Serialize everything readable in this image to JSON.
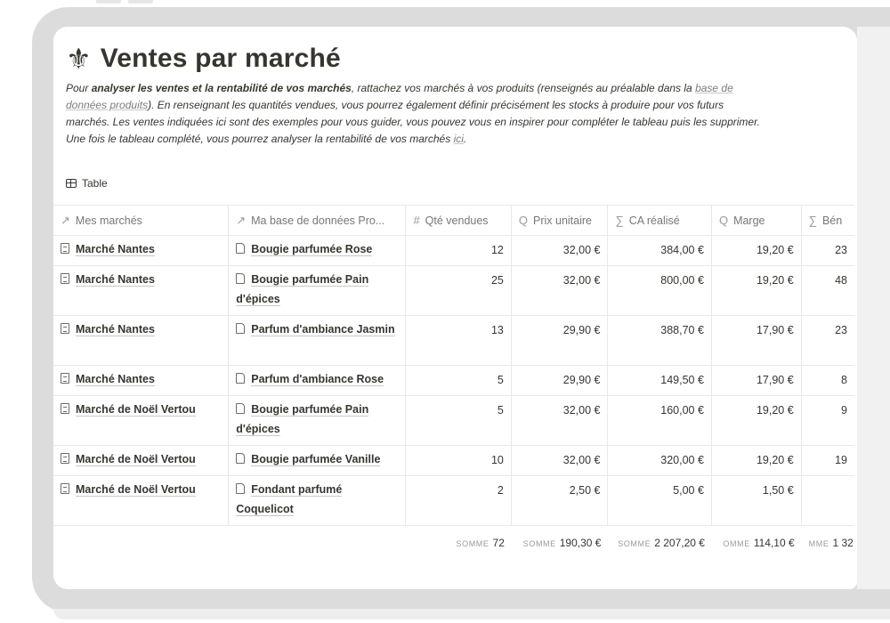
{
  "page": {
    "title": "Ventes par marché",
    "title_icon": "fleur-de-lis-icon",
    "description": {
      "p1": "Pour ",
      "b1": "analyser les ventes et la rentabilité de vos marchés",
      "p2": ", rattachez vos marchés à vos produits (renseignés au préalable dans la ",
      "link1": "base de données produits",
      "p3": "). En renseignant les quantités vendues, vous pourrez également définir précisément les stocks à produire pour vos futurs marchés. Les ventes indiquées ici sont des exemples pour vous guider, vous pouvez vous en inspirer pour compléter le tableau puis les supprimer. Une fois le tableau complété, vous pourrez analyser la rentabilité de vos marchés ",
      "link2": "ici",
      "p4": "."
    },
    "view_tab": "Table"
  },
  "columns": [
    {
      "icon": "↗",
      "label": "Mes marchés"
    },
    {
      "icon": "↗",
      "label": "Ma base de données Pro..."
    },
    {
      "icon": "#",
      "label": "Qté vendues"
    },
    {
      "icon": "Q",
      "label": "Prix unitaire"
    },
    {
      "icon": "∑",
      "label": "CA réalisé"
    },
    {
      "icon": "Q",
      "label": "Marge"
    },
    {
      "icon": "∑",
      "label": "Bén"
    }
  ],
  "rows": [
    {
      "market": "Marché Nantes",
      "product": "Bougie parfumée Rose",
      "qty": "12",
      "price": "32,00 €",
      "ca": "384,00 €",
      "margin": "19,20 €",
      "ben": "23"
    },
    {
      "market": "Marché Nantes",
      "product": "Bougie parfumée Pain d'épices",
      "qty": "25",
      "price": "32,00 €",
      "ca": "800,00 €",
      "margin": "19,20 €",
      "ben": "48"
    },
    {
      "market": "Marché Nantes",
      "product": "Parfum d'ambiance Jasmin",
      "qty": "13",
      "price": "29,90 €",
      "ca": "388,70 €",
      "margin": "17,90 €",
      "ben": "23"
    },
    {
      "market": "Marché Nantes",
      "product": "Parfum d'ambiance Rose",
      "qty": "5",
      "price": "29,90 €",
      "ca": "149,50 €",
      "margin": "17,90 €",
      "ben": "8"
    },
    {
      "market": "Marché de Noël Vertou",
      "product": "Bougie parfumée Pain d'épices",
      "qty": "5",
      "price": "32,00 €",
      "ca": "160,00 €",
      "margin": "19,20 €",
      "ben": "9"
    },
    {
      "market": "Marché de Noël Vertou",
      "product": "Bougie parfumée Vanille",
      "qty": "10",
      "price": "32,00 €",
      "ca": "320,00 €",
      "margin": "19,20 €",
      "ben": "19"
    },
    {
      "market": "Marché de Noël Vertou",
      "product": "Fondant parfumé Coquelicot",
      "qty": "2",
      "price": "2,50 €",
      "ca": "5,00 €",
      "margin": "1,50 €",
      "ben": ""
    }
  ],
  "totals": [
    {
      "label": "SOMME",
      "value": "72"
    },
    {
      "label": "SOMME",
      "value": "190,30 €"
    },
    {
      "label": "SOMME",
      "value": "2 207,20 €"
    },
    {
      "label": "OMME",
      "value": "114,10 €"
    },
    {
      "label": "MME",
      "value": "1 32"
    }
  ]
}
